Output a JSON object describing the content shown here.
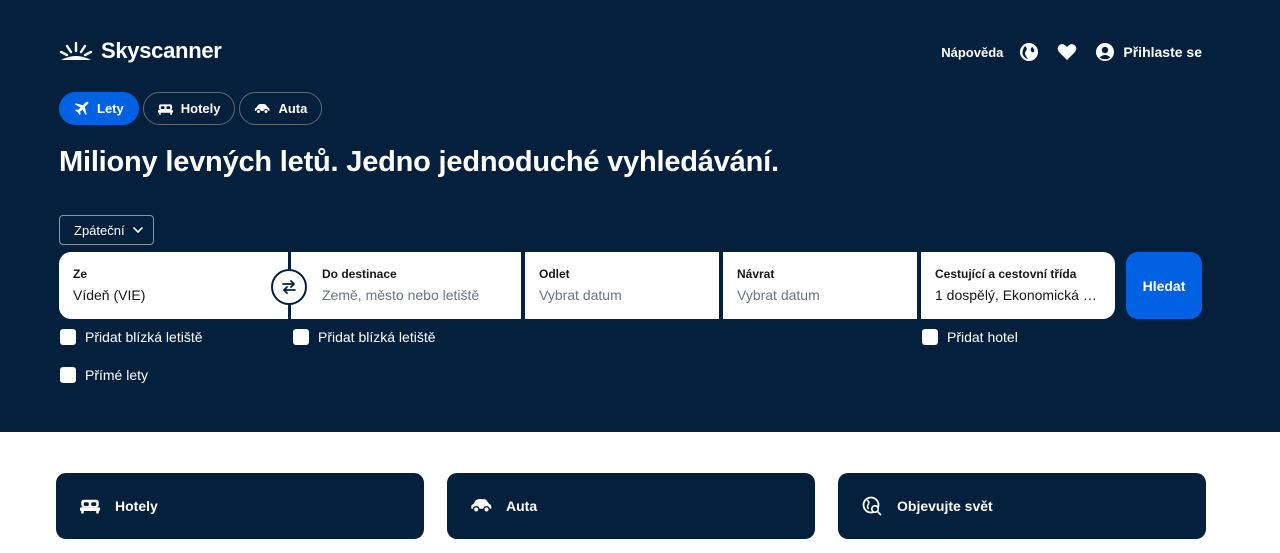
{
  "header": {
    "brand": "Skyscanner",
    "help": "Nápověda",
    "login": "Přihlaste se",
    "icons": [
      "globe-icon",
      "heart-icon",
      "user-icon"
    ]
  },
  "tabs": [
    {
      "label": "Lety",
      "icon": "plane-icon",
      "active": true
    },
    {
      "label": "Hotely",
      "icon": "bed-icon",
      "active": false
    },
    {
      "label": "Auta",
      "icon": "car-icon",
      "active": false
    }
  ],
  "headline": "Miliony levných letů. Jedno jednoduché vyhledávání.",
  "trip_type": "Zpáteční",
  "search": {
    "from": {
      "label": "Ze",
      "value": "Vídeň (VIE)"
    },
    "to": {
      "label": "Do destinace",
      "placeholder": "Země, město nebo letiště"
    },
    "depart": {
      "label": "Odlet",
      "placeholder": "Vybrat datum"
    },
    "return": {
      "label": "Návrat",
      "placeholder": "Vybrat datum"
    },
    "travellers": {
      "label": "Cestující a cestovní třída",
      "value": "1 dospělý, Ekonomická …"
    },
    "button": "Hledat"
  },
  "options": {
    "nearby_from": "Přidat blízká letiště",
    "nearby_to": "Přidat blízká letiště",
    "add_hotel": "Přidat hotel",
    "direct": "Přímé lety"
  },
  "cards": [
    {
      "label": "Hotely",
      "icon": "bed-icon"
    },
    {
      "label": "Auta",
      "icon": "car-icon"
    },
    {
      "label": "Objevujte svět",
      "icon": "globe-search-icon"
    }
  ],
  "colors": {
    "brand_bg": "#05203c",
    "accent": "#0062e3"
  }
}
